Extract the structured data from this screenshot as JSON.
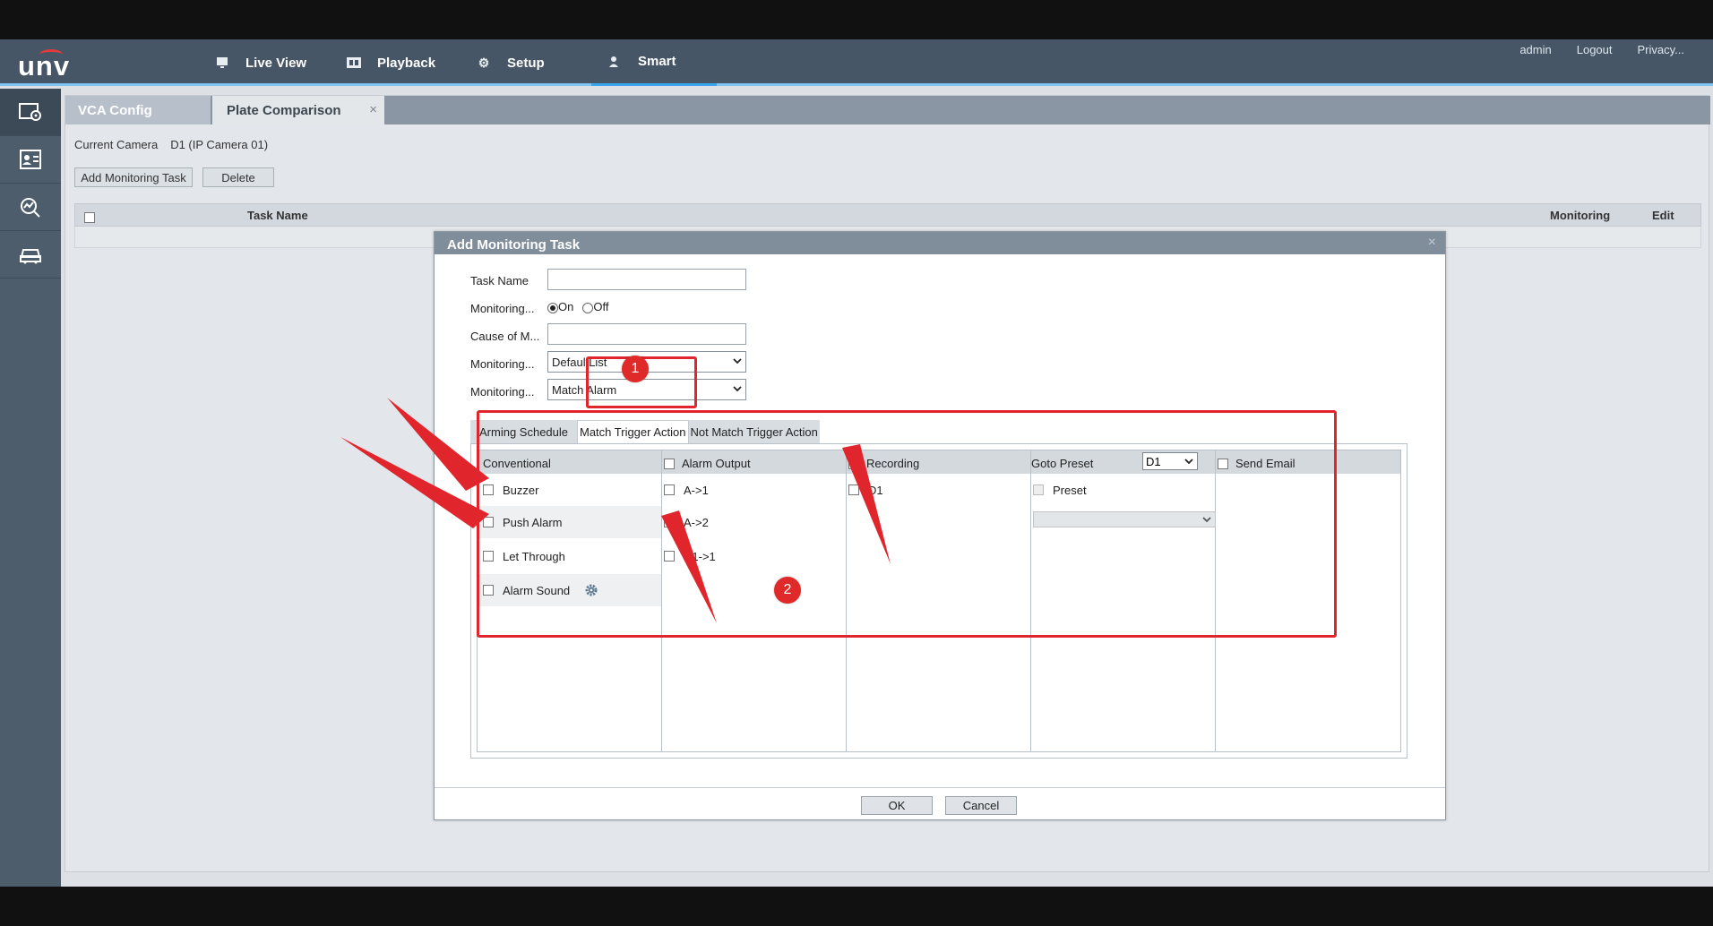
{
  "brand": {
    "logo_text": "unv"
  },
  "nav": {
    "live_view": "Live View",
    "playback": "Playback",
    "setup": "Setup",
    "smart": "Smart"
  },
  "top_links": {
    "user": "admin",
    "logout": "Logout",
    "privacy": "Privacy..."
  },
  "tabs": {
    "vca_config": "VCA Config",
    "plate_comparison": "Plate Comparison",
    "close_glyph": "×"
  },
  "camera": {
    "label": "Current Camera",
    "value": "D1 (IP Camera 01)"
  },
  "toolbar": {
    "add_task": "Add Monitoring Task",
    "delete": "Delete"
  },
  "table": {
    "columns": {
      "task_name": "Task Name",
      "monitoring": "Monitoring",
      "edit": "Edit"
    }
  },
  "dialog": {
    "title": "Add Monitoring Task",
    "close_glyph": "×",
    "fields": {
      "task_name": {
        "label": "Task Name",
        "value": ""
      },
      "monitoring_status": {
        "label": "Monitoring...",
        "on": "On",
        "off": "Off",
        "selected": "On"
      },
      "cause": {
        "label": "Cause of M...",
        "value": ""
      },
      "monitoring_list": {
        "label": "Monitoring...",
        "value": "DefaultList"
      },
      "monitoring_condition": {
        "label": "Monitoring...",
        "value": "Match Alarm"
      }
    },
    "subtabs": [
      "Arming Schedule",
      "Match Trigger Action",
      "Not Match Trigger Action"
    ],
    "active_subtab": "Match Trigger Action",
    "columns": {
      "conventional": "Conventional",
      "alarm_output": "Alarm Output",
      "recording": "Recording",
      "goto_preset": "Goto Preset",
      "goto_preset_camera": "D1",
      "send_email": "Send Email"
    },
    "conventional_items": [
      "Buzzer",
      "Push Alarm",
      "Let Through",
      "Alarm Sound"
    ],
    "alarm_output_items": [
      "A->1",
      "A->2",
      "D1->1"
    ],
    "recording_items": [
      "D1"
    ],
    "preset_item": "Preset",
    "ok": "OK",
    "cancel": "Cancel"
  },
  "annotations": {
    "badge_1": "1",
    "badge_2": "2",
    "color": "#e0262c"
  }
}
